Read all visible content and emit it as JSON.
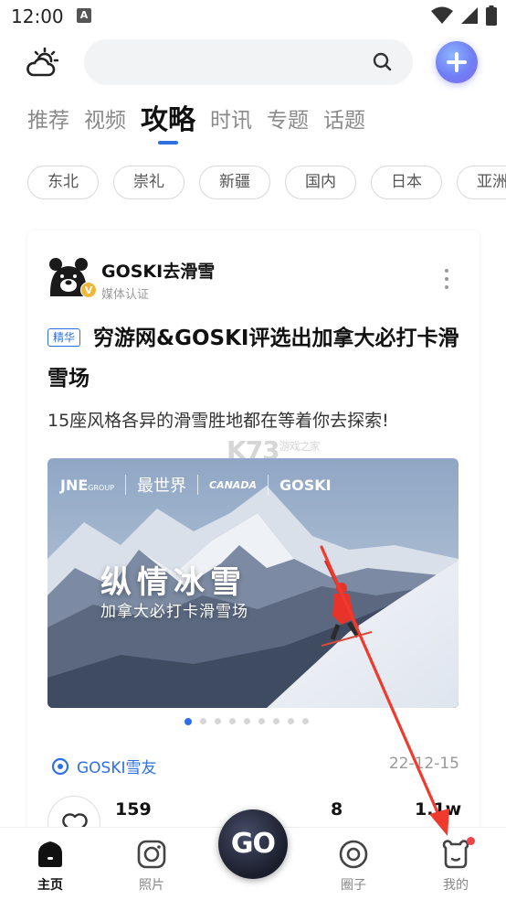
{
  "status_bar": {
    "time": "12:00",
    "notif_icon": "A"
  },
  "header": {
    "weather_icon": "partly-cloudy-icon",
    "search_placeholder": "",
    "add_icon": "plus-icon"
  },
  "tabs": [
    {
      "label": "推荐",
      "active": false
    },
    {
      "label": "视频",
      "active": false
    },
    {
      "label": "攻略",
      "active": true
    },
    {
      "label": "时讯",
      "active": false
    },
    {
      "label": "专题",
      "active": false
    },
    {
      "label": "话题",
      "active": false
    }
  ],
  "regions": [
    "东北",
    "崇礼",
    "新疆",
    "国内",
    "日本",
    "亚洲"
  ],
  "post": {
    "author": "GOSKI去滑雪",
    "author_sub": "媒体认证",
    "verified_badge": "V",
    "tag": "精华",
    "title": "穷游网&GOSKI评选出加拿大必打卡滑雪场",
    "description": "15座风格各异的滑雪胜地都在等着你去探索!",
    "watermark": "K73",
    "watermark_sub": "游戏之家",
    "banner": {
      "brand_jne": "JNE",
      "brand_jne_sub": "GROUP",
      "brand_zuishijie": "最世界",
      "brand_canada": "CANADA",
      "brand_goski": "GOSKI",
      "headline": "纵情冰雪",
      "subline": "加拿大必打卡滑雪场"
    },
    "carousel": {
      "count": 9,
      "active_index": 0
    },
    "circle": "GOSKI雪友",
    "date": "22-12-15",
    "stats": {
      "likes": "159",
      "comments": "8",
      "views": "1.1w"
    }
  },
  "bottom_nav": [
    {
      "label": "主页",
      "icon": "home-icon",
      "active": true
    },
    {
      "label": "照片",
      "icon": "camera-icon",
      "active": false
    },
    {
      "label": "GO",
      "icon": "go-icon",
      "active": false
    },
    {
      "label": "圈子",
      "icon": "circle-icon",
      "active": false
    },
    {
      "label": "我的",
      "icon": "bear-icon",
      "active": false
    }
  ],
  "colors": {
    "accent": "#2f6fe4",
    "annotation_arrow": "#f03a2e",
    "notification": "#f0444c"
  }
}
